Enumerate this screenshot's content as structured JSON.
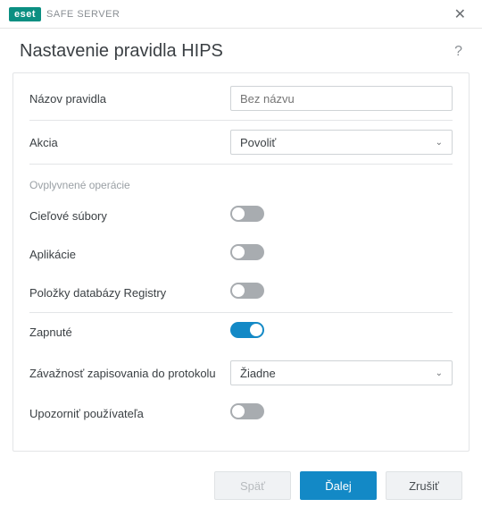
{
  "brand": {
    "badge": "eset",
    "product": "SAFE SERVER"
  },
  "header": {
    "title": "Nastavenie pravidla HIPS"
  },
  "fields": {
    "ruleNameLabel": "Názov pravidla",
    "ruleNamePlaceholder": "Bez názvu",
    "actionLabel": "Akcia",
    "actionValue": "Povoliť",
    "affectedOpsLabel": "Ovplyvnené operácie",
    "targetFilesLabel": "Cieľové súbory",
    "applicationsLabel": "Aplikácie",
    "registryEntriesLabel": "Položky databázy Registry",
    "enabledLabel": "Zapnuté",
    "logSeverityLabel": "Závažnosť zapisovania do protokolu",
    "logSeverityValue": "Žiadne",
    "notifyUserLabel": "Upozorniť používateľa"
  },
  "toggles": {
    "targetFiles": false,
    "applications": false,
    "registryEntries": false,
    "enabled": true,
    "notifyUser": false
  },
  "footer": {
    "back": "Späť",
    "next": "Ďalej",
    "cancel": "Zrušiť"
  }
}
